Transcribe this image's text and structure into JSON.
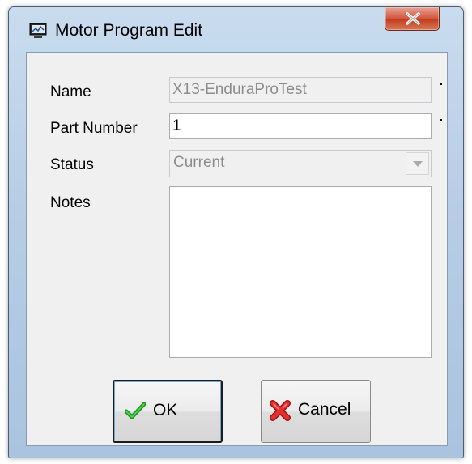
{
  "window": {
    "title": "Motor Program Edit",
    "icon": "monitor-icon",
    "close_icon": "close-icon"
  },
  "form": {
    "name": {
      "label": "Name",
      "value": "X13-EnduraProTest",
      "required": true,
      "readonly": true
    },
    "part_number": {
      "label": "Part Number",
      "value": "1",
      "required": true
    },
    "status": {
      "label": "Status",
      "value": "Current",
      "disabled": true
    },
    "notes": {
      "label": "Notes",
      "value": ""
    }
  },
  "buttons": {
    "ok": {
      "label": "OK",
      "icon": "checkmark-icon"
    },
    "cancel": {
      "label": "Cancel",
      "icon": "red-x-icon"
    }
  },
  "colors": {
    "title_bar": "#b6cde5",
    "close_button": "#c23a1e",
    "client_background": "#f0f0f0",
    "ok_check": "#1f9a1f",
    "cancel_x": "#d42020"
  }
}
